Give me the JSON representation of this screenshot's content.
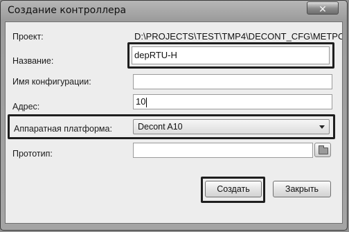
{
  "window": {
    "title": "Создание контроллера",
    "close_glyph": "✕"
  },
  "form": {
    "project": {
      "label": "Проект:",
      "value": "D:\\PROJECTS\\TEST\\TMP4\\DECONT_CFG\\METPO"
    },
    "name": {
      "label": "Название:",
      "value": "depRTU-H"
    },
    "config_name": {
      "label": "Имя конфигурации:",
      "value": ""
    },
    "address": {
      "label": "Адрес:",
      "value": "10"
    },
    "platform": {
      "label": "Аппаратная платформа:",
      "selected": "Decont A10"
    },
    "prototype": {
      "label": "Прототип:",
      "value": ""
    }
  },
  "buttons": {
    "create": "Создать",
    "close": "Закрыть"
  },
  "icons": {
    "close": "close-icon",
    "dropdown": "chevron-down-icon",
    "browse": "folder-icon"
  }
}
